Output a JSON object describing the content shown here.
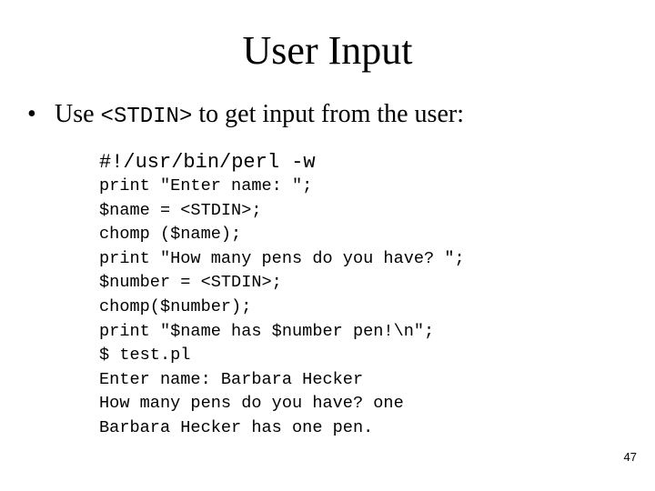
{
  "slide": {
    "title": "User Input",
    "bullet": {
      "marker": "•",
      "text_before": "Use ",
      "code": "<STDIN>",
      "text_after": " to get input from the user:"
    },
    "shebang": "#!/usr/bin/perl -w",
    "code_lines": [
      "print \"Enter name: \";",
      "$name = <STDIN>;",
      "chomp ($name);",
      "print \"How many pens do you have? \";",
      "$number = <STDIN>;",
      "chomp($number);",
      "print \"$name has $number pen!\\n\";",
      "$ test.pl",
      "Enter name: Barbara Hecker",
      "How many pens do you have? one",
      "Barbara Hecker has one pen."
    ],
    "page_number": "47"
  }
}
